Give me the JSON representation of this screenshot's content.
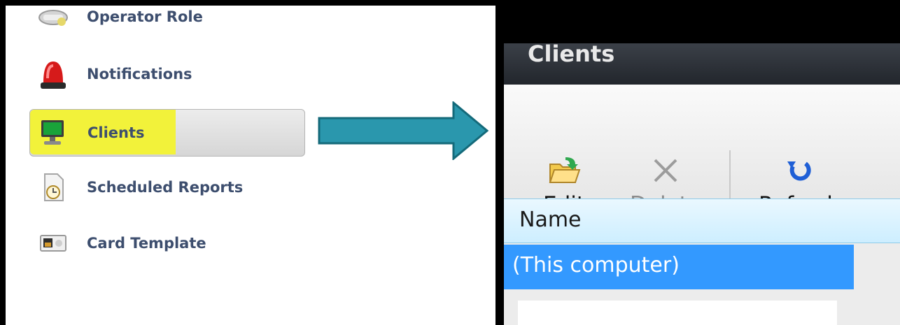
{
  "sidebar": {
    "items": [
      {
        "label": "Operator Role",
        "icon": "operator-role-icon"
      },
      {
        "label": "Notifications",
        "icon": "siren-icon"
      },
      {
        "label": "Clients",
        "icon": "monitor-icon",
        "highlight_color": "#f2f23a"
      },
      {
        "label": "Scheduled Reports",
        "icon": "clock-document-icon"
      },
      {
        "label": "Card Template",
        "icon": "id-card-icon"
      }
    ]
  },
  "arrow": {
    "color": "#2a97ad",
    "icon": "right-arrow-icon"
  },
  "panel": {
    "title": "Clients",
    "toolbar": {
      "edit_label": "Edit",
      "delete_label": "Delete",
      "refresh_label": "Refresh"
    },
    "table": {
      "columns": [
        "Name"
      ],
      "rows": [
        [
          "(This computer)"
        ]
      ],
      "selected_row": 0,
      "selection_color": "#3399ff"
    }
  }
}
